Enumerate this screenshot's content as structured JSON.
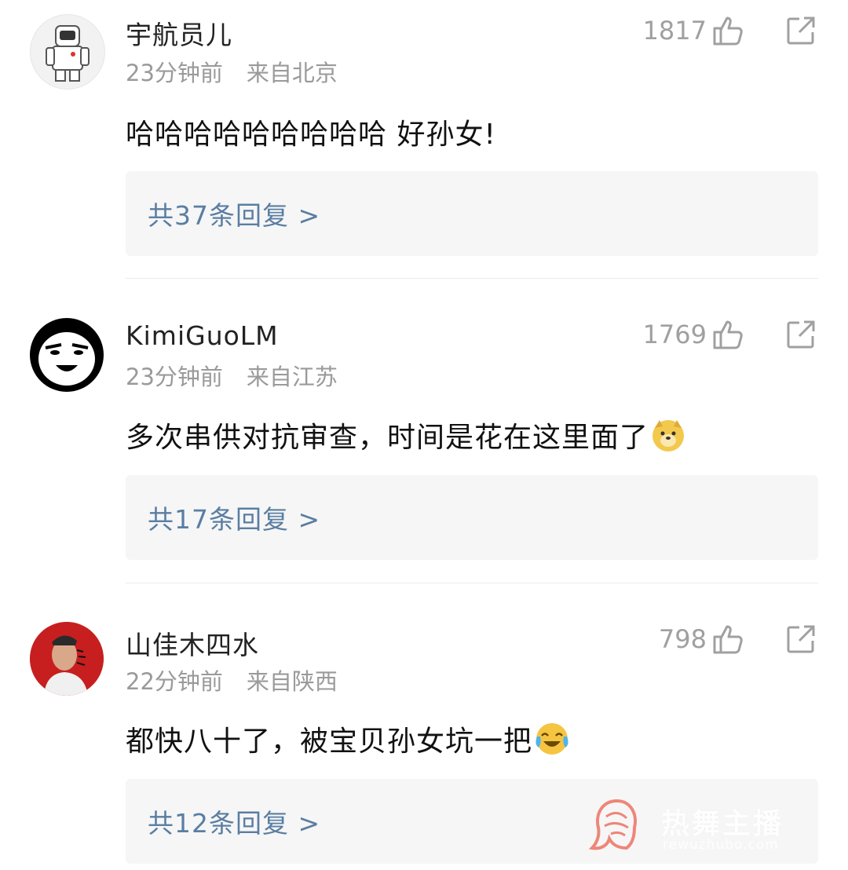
{
  "comments": [
    {
      "username": "宇航员儿",
      "time": "23分钟前",
      "location": "来自北京",
      "likes": "1817",
      "text": "哈哈哈哈哈哈哈哈哈 好孙女!",
      "emoji": "",
      "replies": "共37条回复 >",
      "avatar_icon": "astronaut-avatar-icon"
    },
    {
      "username": "KimiGuoLM",
      "time": "23分钟前",
      "location": "来自江苏",
      "likes": "1769",
      "text": "多次串供对抗审查，时间是花在这里面了",
      "emoji": "doge-emoji-icon",
      "replies": "共17条回复 >",
      "avatar_icon": "meme-face-avatar-icon"
    },
    {
      "username": "山佳木四水",
      "time": "22分钟前",
      "location": "来自陕西",
      "likes": "798",
      "text": "都快八十了，被宝贝孙女坑一把",
      "emoji": "laugh-cry-emoji-icon",
      "replies": "共12条回复 >",
      "avatar_icon": "photo-avatar-icon"
    }
  ],
  "watermark": {
    "title": "热舞主播",
    "url": "rewuzhubo.com"
  },
  "colors": {
    "reply_link": "#5a7ea3",
    "reply_bg": "#f6f6f6",
    "meta": "#9a9a9a"
  }
}
